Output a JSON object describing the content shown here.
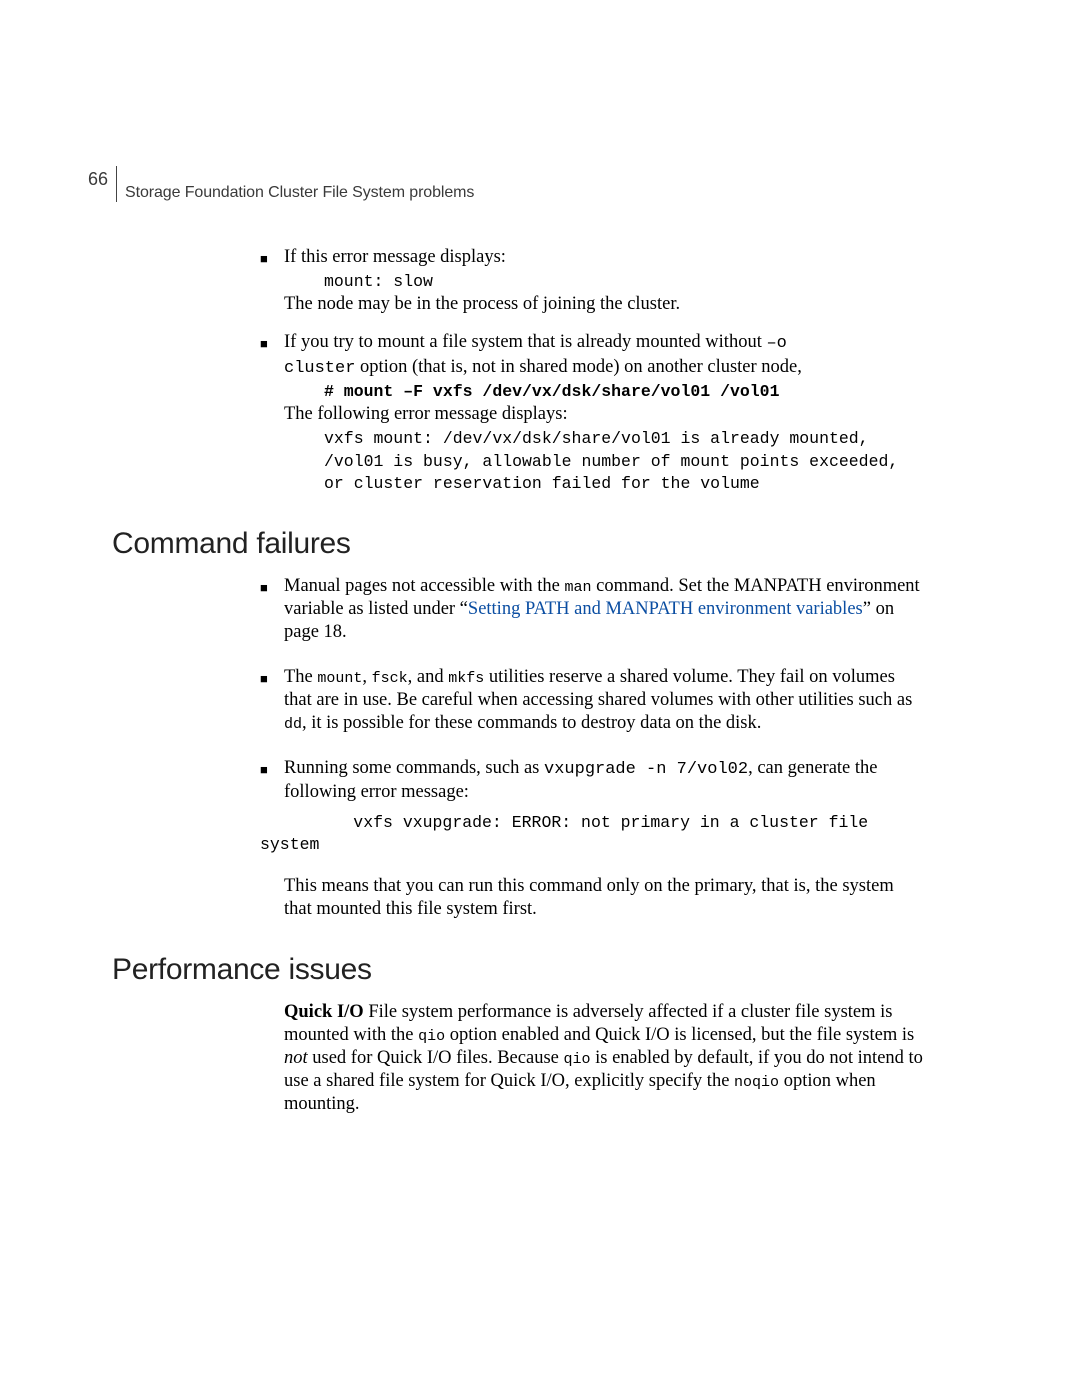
{
  "header": {
    "page_number": "66",
    "running_title": "Storage Foundation Cluster File System problems"
  },
  "intro_bullets": [
    {
      "line1": "If this error message displays:",
      "code1": "mount: slow",
      "line2": "The node may be in the process of joining the cluster."
    },
    {
      "line1_a": "If you try to mount a file system that is already mounted without ",
      "line1_b_mono": "–o",
      "line2_a_mono": "cluster",
      "line2_b": " option (that is, not in shared mode) on another cluster node,",
      "code_cmd": "# mount –F vxfs /dev/vx/dsk/share/vol01 /vol01",
      "line3": "The following error message displays:",
      "code_block": "vxfs mount: /dev/vx/dsk/share/vol01 is already mounted,\n/vol01 is busy, allowable number of mount points exceeded,\nor cluster reservation failed for the volume"
    }
  ],
  "sections": {
    "command_failures": {
      "title": "Command failures",
      "bullets": [
        {
          "t1": "Manual pages not accessible with the ",
          "t1_mono": "man",
          "t1b": " command. Set the MANPATH environment variable as listed under “",
          "link_text": "Setting PATH and MANPATH environment variables",
          "t1c": "” on page 18."
        },
        {
          "t2a": "The ",
          "t2_mono1": "mount",
          "t2b": ", ",
          "t2_mono2": "fsck",
          "t2c": ", and ",
          "t2_mono3": "mkfs",
          "t2d": " utilities reserve a shared volume. They fail on volumes that are in use. Be careful when accessing shared volumes with other utilities such as ",
          "t2_mono4": "dd",
          "t2e": ", it is possible for these commands to destroy data on the disk."
        },
        {
          "t3a": "Running some commands, such as ",
          "t3_mono1": "vxupgrade -n 7/vol02",
          "t3b": ", can generate the following error message:",
          "code_line": "       vxfs vxupgrade: ERROR: not primary in a cluster file",
          "code_line_wrap": "system",
          "t3c": "This means that you can run this command only on the primary, that is, the system that mounted this file system first."
        }
      ]
    },
    "performance_issues": {
      "title": "Performance issues",
      "p1_bold": "Quick I/O",
      "p1a": " File system performance is adversely affected if a cluster file system is mounted with the ",
      "p1_mono1": "qio",
      "p1b": " option enabled and Quick I/O is licensed, but the file system is ",
      "p1_ital": "not",
      "p1c": " used for Quick I/O files. Because ",
      "p1_mono2": "qio",
      "p1d": " is enabled by default, if you do not intend to use a shared file system for Quick I/O, explicitly specify the ",
      "p1_mono3": "noqio",
      "p1e": " option when mounting."
    }
  }
}
